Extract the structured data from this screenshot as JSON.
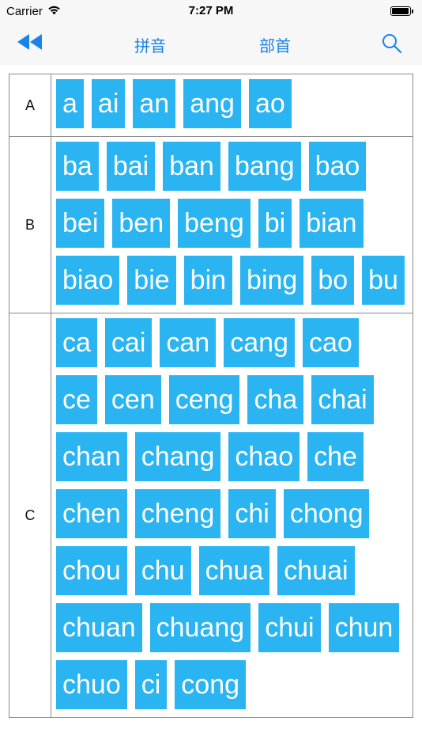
{
  "status_bar": {
    "carrier": "Carrier",
    "time": "7:27 PM",
    "battery_level": 1.0
  },
  "nav": {
    "back_icon": "double-left-arrow-icon",
    "tabs": [
      {
        "label": "拼音"
      },
      {
        "label": "部首"
      }
    ],
    "search_icon": "search-icon"
  },
  "colors": {
    "accent": "#1a83ea",
    "syllable_bg": "#2ab4f2",
    "syllable_text": "#ffffff",
    "grid_line": "#8a8a8a",
    "bar_bg": "#f7f7f7"
  },
  "groups": [
    {
      "letter": "A",
      "syllables": [
        "a",
        "ai",
        "an",
        "ang",
        "ao"
      ]
    },
    {
      "letter": "B",
      "syllables": [
        "ba",
        "bai",
        "ban",
        "bang",
        "bao",
        "bei",
        "ben",
        "beng",
        "bi",
        "bian",
        "biao",
        "bie",
        "bin",
        "bing",
        "bo",
        "bu"
      ]
    },
    {
      "letter": "C",
      "syllables": [
        "ca",
        "cai",
        "can",
        "cang",
        "cao",
        "ce",
        "cen",
        "ceng",
        "cha",
        "chai",
        "chan",
        "chang",
        "chao",
        "che",
        "chen",
        "cheng",
        "chi",
        "chong",
        "chou",
        "chu",
        "chua",
        "chuai",
        "chuan",
        "chuang",
        "chui",
        "chun",
        "chuo",
        "ci",
        "cong"
      ]
    }
  ]
}
